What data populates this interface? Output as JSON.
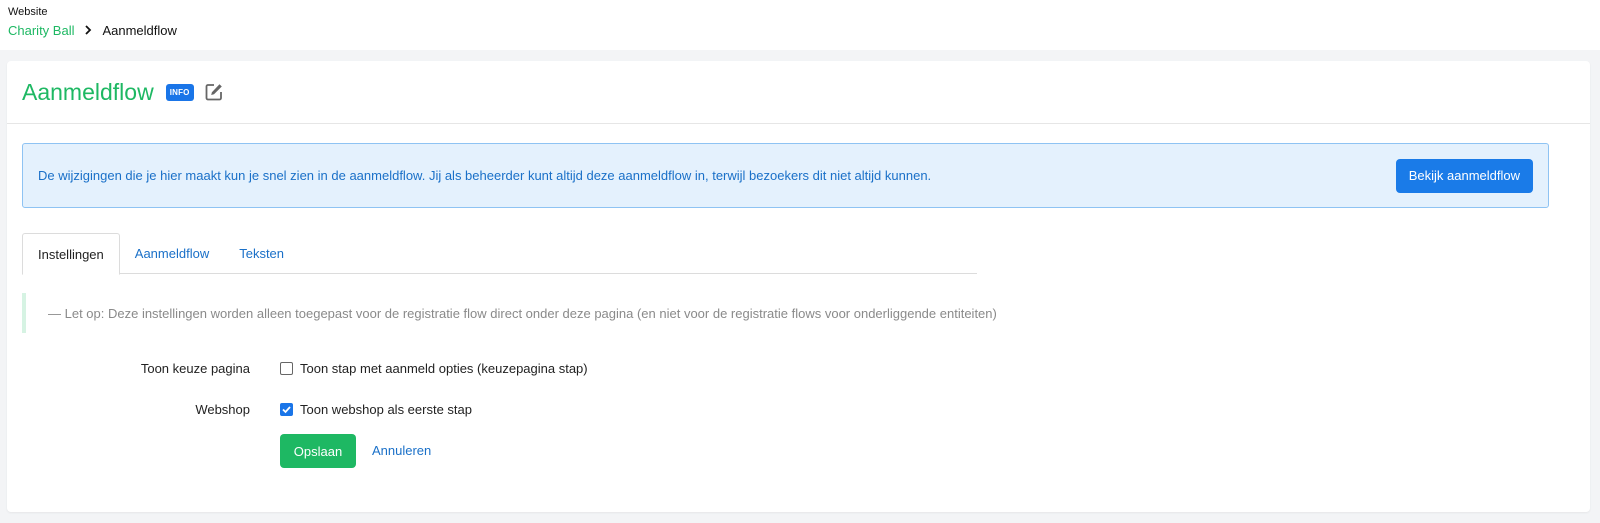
{
  "breadcrumb": {
    "section": "Website",
    "parent": "Charity Ball",
    "current": "Aanmeldflow"
  },
  "header": {
    "title": "Aanmeldflow",
    "badge": "INFO"
  },
  "alert": {
    "text": "De wijzigingen die je hier maakt kun je snel zien in de aanmeldflow. Jij als beheerder kunt altijd deze aanmeldflow in, terwijl bezoekers dit niet altijd kunnen.",
    "button_label": "Bekijk aanmeldflow"
  },
  "tabs": [
    {
      "label": "Instellingen",
      "active": true
    },
    {
      "label": "Aanmeldflow",
      "active": false
    },
    {
      "label": "Teksten",
      "active": false
    }
  ],
  "note": "— Let op: Deze instellingen worden alleen toegepast voor de registratie flow direct onder deze pagina (en niet voor de registratie flows voor onderliggende entiteiten)",
  "form": {
    "fields": [
      {
        "label": "Toon keuze pagina",
        "checkbox_label": "Toon stap met aanmeld opties (keuzepagina stap)",
        "checked": false
      },
      {
        "label": "Webshop",
        "checkbox_label": "Toon webshop als eerste stap",
        "checked": true
      }
    ],
    "save_label": "Opslaan",
    "cancel_label": "Annuleren"
  },
  "colors": {
    "brand_green": "#1eb863",
    "primary_blue": "#1a7be8",
    "alert_bg": "#e4f1fd"
  },
  "icons": {
    "edit": "edit-icon",
    "breadcrumb_separator": "chevron-right-icon",
    "check": "check-icon"
  }
}
